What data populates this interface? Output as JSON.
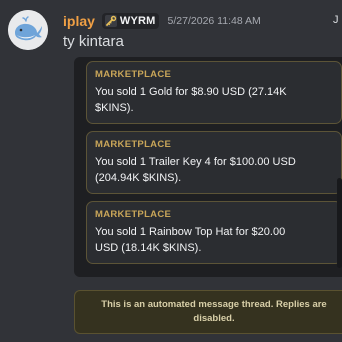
{
  "message": {
    "author": "iplay",
    "badge": {
      "icon": "key-icon",
      "label": "WYRM"
    },
    "timestamp": "5/27/2026 11:48 AM",
    "edge_initial": "J",
    "content": "ty kintara"
  },
  "thread": {
    "cards": [
      {
        "title": "MARKETPLACE",
        "line1": "You sold 1 Gold for $8.90 USD (27.14K",
        "line2": "$KINS)."
      },
      {
        "title": "MARKETPLACE",
        "line1": "You sold 1 Trailer Key 4 for $100.00 USD",
        "line2": "(204.94K $KINS)."
      },
      {
        "title": "MARKETPLACE",
        "line1": "You sold 1 Rainbow Top Hat for $20.00",
        "line2": "USD (18.14K $KINS)."
      }
    ],
    "notice": "This is an automated message thread. Replies are disabled."
  },
  "colors": {
    "background": "#313338",
    "username": "#f0a045",
    "card_title": "#c9a659",
    "card_border": "#5c5437",
    "thread_bg": "#1e1f22",
    "notice_bg": "#35321f",
    "avatar_bg": "#e9eaec",
    "avatar_whale": "#6fa4d9"
  }
}
